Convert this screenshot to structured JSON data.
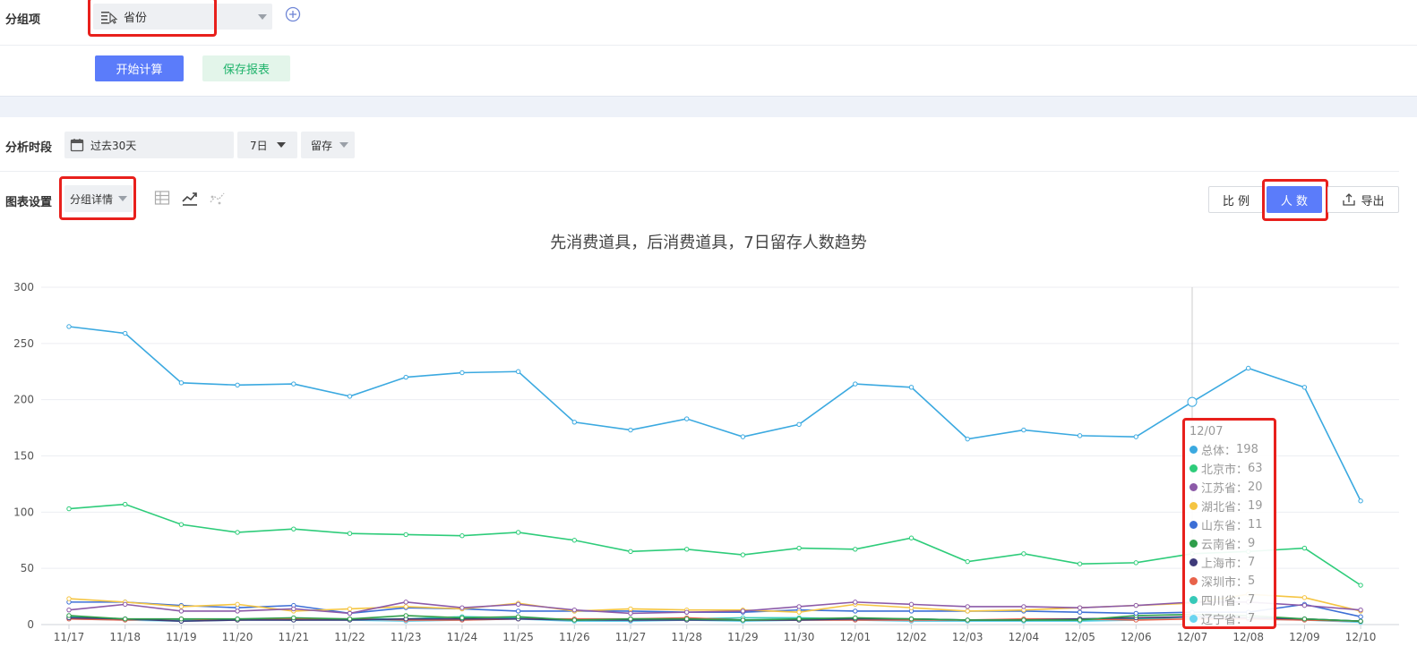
{
  "group": {
    "label": "分组项",
    "field_value": "省份"
  },
  "actions": {
    "calculate": "开始计算",
    "save_report": "保存报表"
  },
  "period": {
    "label": "分析时段",
    "range": "过去30天",
    "window": "7日",
    "metric": "留存"
  },
  "chart_settings": {
    "label": "图表设置",
    "mode": "分组详情",
    "ratio_button": "比 例",
    "count_button": "人 数",
    "export_button": "导出"
  },
  "colors": {
    "primary": "#5b7cfa",
    "save_green": "#1fb36b",
    "highlight_red": "#e8201c"
  },
  "chart_data": {
    "type": "line",
    "title": "先消费道具，后消费道具，7日留存人数趋势",
    "x": [
      "11/17",
      "11/18",
      "11/19",
      "11/20",
      "11/21",
      "11/22",
      "11/23",
      "11/24",
      "11/25",
      "11/26",
      "11/27",
      "11/28",
      "11/29",
      "11/30",
      "12/01",
      "12/02",
      "12/03",
      "12/04",
      "12/05",
      "12/06",
      "12/07",
      "12/08",
      "12/09",
      "12/10"
    ],
    "yticks": [
      0,
      50,
      100,
      150,
      200,
      250,
      300
    ],
    "ylim": [
      0,
      300
    ],
    "grid": true,
    "series": [
      {
        "name": "总体",
        "color": "#3ba9e0",
        "values": [
          265,
          259,
          215,
          213,
          214,
          203,
          220,
          224,
          225,
          180,
          173,
          183,
          167,
          178,
          214,
          211,
          165,
          173,
          168,
          167,
          198,
          228,
          211,
          110
        ]
      },
      {
        "name": "北京市",
        "color": "#2ecc7a",
        "values": [
          103,
          107,
          89,
          82,
          85,
          81,
          80,
          79,
          82,
          75,
          65,
          67,
          62,
          68,
          67,
          77,
          56,
          63,
          54,
          55,
          63,
          65,
          68,
          35
        ]
      },
      {
        "name": "江苏省",
        "color": "#8c5aa8",
        "values": [
          13,
          18,
          12,
          12,
          14,
          10,
          20,
          15,
          18,
          13,
          10,
          11,
          12,
          16,
          20,
          18,
          16,
          16,
          15,
          17,
          20,
          20,
          17,
          13
        ]
      },
      {
        "name": "湖北省",
        "color": "#f5c542",
        "values": [
          23,
          20,
          16,
          18,
          12,
          14,
          16,
          14,
          19,
          12,
          14,
          13,
          13,
          11,
          18,
          15,
          12,
          13,
          15,
          17,
          19,
          27,
          24,
          12
        ]
      },
      {
        "name": "山东省",
        "color": "#3d6fd6",
        "values": [
          20,
          20,
          17,
          15,
          17,
          10,
          15,
          14,
          12,
          12,
          12,
          11,
          11,
          13,
          12,
          12,
          12,
          12,
          11,
          10,
          11,
          11,
          18,
          7
        ]
      },
      {
        "name": "云南省",
        "color": "#2e9e4a",
        "values": [
          8,
          5,
          5,
          5,
          6,
          5,
          8,
          6,
          7,
          4,
          5,
          5,
          4,
          5,
          6,
          5,
          4,
          4,
          4,
          8,
          9,
          8,
          5,
          3
        ]
      },
      {
        "name": "上海市",
        "color": "#3e3a7a",
        "values": [
          6,
          5,
          3,
          4,
          4,
          4,
          5,
          5,
          5,
          4,
          4,
          4,
          4,
          4,
          5,
          5,
          4,
          4,
          5,
          6,
          7,
          6,
          5,
          3
        ]
      },
      {
        "name": "深圳市",
        "color": "#e8624a",
        "values": [
          5,
          4,
          5,
          4,
          5,
          5,
          4,
          4,
          5,
          5,
          5,
          6,
          4,
          4,
          4,
          4,
          4,
          5,
          5,
          4,
          5,
          5,
          4,
          3
        ]
      },
      {
        "name": "四川省",
        "color": "#36c9b8",
        "values": [
          7,
          5,
          4,
          5,
          4,
          5,
          5,
          7,
          6,
          4,
          5,
          5,
          6,
          6,
          5,
          5,
          4,
          4,
          4,
          5,
          7,
          6,
          5,
          3
        ]
      },
      {
        "name": "辽宁省",
        "color": "#6ad4f0",
        "values": [
          5,
          4,
          3,
          4,
          4,
          4,
          3,
          4,
          5,
          3,
          3,
          4,
          3,
          4,
          4,
          3,
          3,
          3,
          3,
          4,
          7,
          5,
          4,
          2
        ]
      }
    ],
    "tooltip": {
      "date": "12/07",
      "index": 20,
      "rows": [
        {
          "name": "总体",
          "value": "198"
        },
        {
          "name": "北京市",
          "value": "63"
        },
        {
          "name": "江苏省",
          "value": "20"
        },
        {
          "name": "湖北省",
          "value": "19"
        },
        {
          "name": "山东省",
          "value": "11"
        },
        {
          "name": "云南省",
          "value": "9"
        },
        {
          "name": "上海市",
          "value": "7"
        },
        {
          "name": "深圳市",
          "value": "5"
        },
        {
          "name": "四川省",
          "value": "7"
        },
        {
          "name": "辽宁省",
          "value": "7"
        }
      ]
    }
  }
}
